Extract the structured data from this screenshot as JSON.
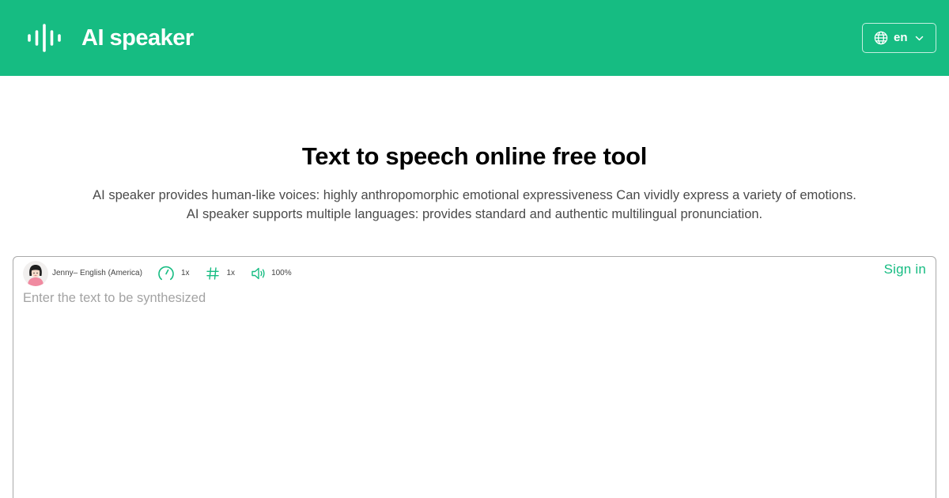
{
  "header": {
    "brand": "AI speaker",
    "brand_color": "#16bc82",
    "logo_icon": "sound-wave-icon",
    "language": {
      "icon": "globe-icon",
      "label": "en",
      "chevron_icon": "chevron-down-icon"
    }
  },
  "hero": {
    "title": "Text to speech online free tool",
    "description_lines": [
      "AI speaker provides human-like voices: highly anthropomorphic emotional expressiveness Can vividly express a variety of emotions.",
      "AI speaker supports multiple languages: provides standard and authentic multilingual pronunciation."
    ]
  },
  "editor": {
    "voice": {
      "avatar_icon": "female-avatar-icon",
      "label": "Jenny– English (America)"
    },
    "speed": {
      "icon": "speedometer-icon",
      "value": "1x"
    },
    "pitch": {
      "icon": "hash-icon",
      "value": "1x"
    },
    "volume": {
      "icon": "speaker-icon",
      "value": "100%"
    },
    "sign_in_label": "Sign in",
    "text_input": {
      "placeholder": "Enter the text to be synthesized",
      "value": ""
    }
  }
}
